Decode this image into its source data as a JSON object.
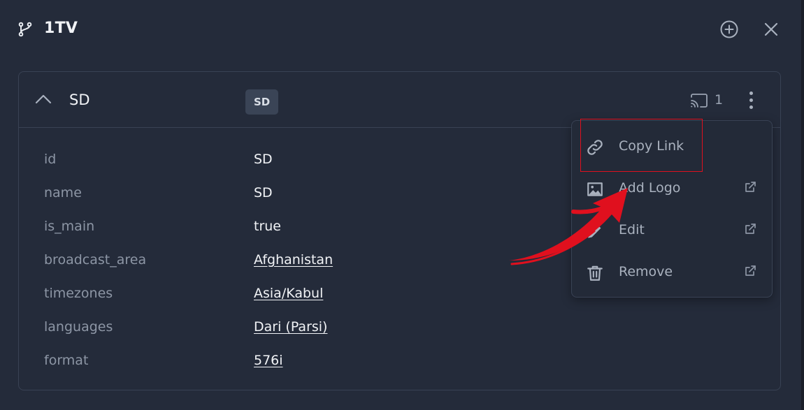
{
  "header": {
    "title": "1TV",
    "icons": {
      "branch": "git-branch-icon",
      "add": "plus-circle-icon",
      "close": "close-icon"
    }
  },
  "feed": {
    "name": "SD",
    "badge": "SD",
    "cast_count": "1",
    "icons": {
      "collapse": "chevron-up-icon",
      "cast": "cast-icon",
      "more": "kebab-menu-icon"
    }
  },
  "details": {
    "rows": [
      {
        "label": "id",
        "value": "SD",
        "link": false
      },
      {
        "label": "name",
        "value": "SD",
        "link": false
      },
      {
        "label": "is_main",
        "value": "true",
        "link": false
      },
      {
        "label": "broadcast_area",
        "value": "Afghanistan",
        "link": true
      },
      {
        "label": "timezones",
        "value": "Asia/Kabul",
        "link": true
      },
      {
        "label": "languages",
        "value": "Dari (Parsi)",
        "link": true
      },
      {
        "label": "format",
        "value": "576i",
        "link": true
      }
    ]
  },
  "menu": {
    "items": [
      {
        "label": "Copy Link",
        "icon": "link-icon",
        "external": false
      },
      {
        "label": "Add Logo",
        "icon": "image-icon",
        "external": true
      },
      {
        "label": "Edit",
        "icon": "pencil-icon",
        "external": true
      },
      {
        "label": "Remove",
        "icon": "trash-icon",
        "external": true
      }
    ]
  },
  "colors": {
    "background": "#242b3a",
    "text": "#f1f3f6",
    "muted": "#8d96a5",
    "border": "#394254",
    "annotation": "#e0101e"
  }
}
